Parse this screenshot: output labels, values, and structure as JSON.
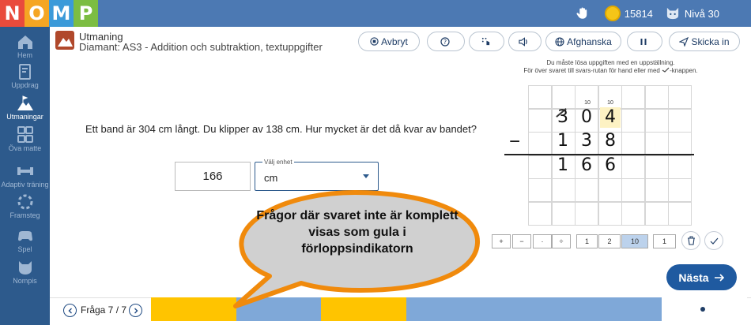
{
  "logo": [
    "N",
    "O",
    "M",
    "P"
  ],
  "logo_colors": [
    "#e94b3c",
    "#f5a623",
    "#3b9ad9",
    "#7cbd42"
  ],
  "topbar": {
    "coins": "15814",
    "level": "Nivå 30"
  },
  "sidebar": {
    "items": [
      {
        "label": "Hem",
        "icon": "home-icon"
      },
      {
        "label": "Uppdrag",
        "icon": "document-edit-icon"
      },
      {
        "label": "Utmaningar",
        "icon": "mountain-flag-icon"
      },
      {
        "label": "Öva matte",
        "icon": "calculator-icon"
      },
      {
        "label": "Adaptiv träning",
        "icon": "dumbbell-icon"
      },
      {
        "label": "Framsteg",
        "icon": "progress-circle-icon"
      },
      {
        "label": "Spel",
        "icon": "gamepad-icon"
      },
      {
        "label": "Nompis",
        "icon": "cat-face-icon"
      }
    ]
  },
  "header": {
    "title": "Utmaning",
    "subtitle": "Diamant: AS3 - Addition och subtraktion, textuppgifter"
  },
  "toolbar": {
    "abort_label": "Avbryt",
    "language_label": "Afghanska",
    "submit_label": "Skicka in"
  },
  "hint": {
    "line1": "Du måste lösa uppgiften med en uppställning.",
    "line2": "För över svaret till svars-rutan för hand eller med",
    "line2_end": "-knappen."
  },
  "question": {
    "text": "Ett band är 304 cm långt. Du klipper av 138 cm. Hur mycket är det då kvar av bandet?",
    "answer": "166",
    "unit_label": "Välj enhet",
    "unit_value": "cm"
  },
  "calc": {
    "carries": [
      "10",
      "10"
    ],
    "row1": [
      "3",
      "0",
      "4"
    ],
    "operator": "−",
    "row2": [
      "1",
      "3",
      "8"
    ],
    "result": [
      "1",
      "6",
      "6"
    ]
  },
  "tools": {
    "ops": [
      "+",
      "−",
      "·",
      "÷"
    ],
    "nums": [
      "1",
      "2",
      "10"
    ],
    "strike_value": "1"
  },
  "next_label": "Nästa",
  "callout": "Frågor där svaret inte är komplett visas som gula i förloppsindikatorn",
  "progress": {
    "label": "Fråga 7 / 7",
    "segments": [
      "yellow",
      "blue",
      "yellow",
      "blue",
      "blue",
      "blue",
      "current"
    ],
    "colors": {
      "yellow": "#ffc400",
      "blue": "#7fa8d8",
      "current": "#ffffff"
    }
  }
}
